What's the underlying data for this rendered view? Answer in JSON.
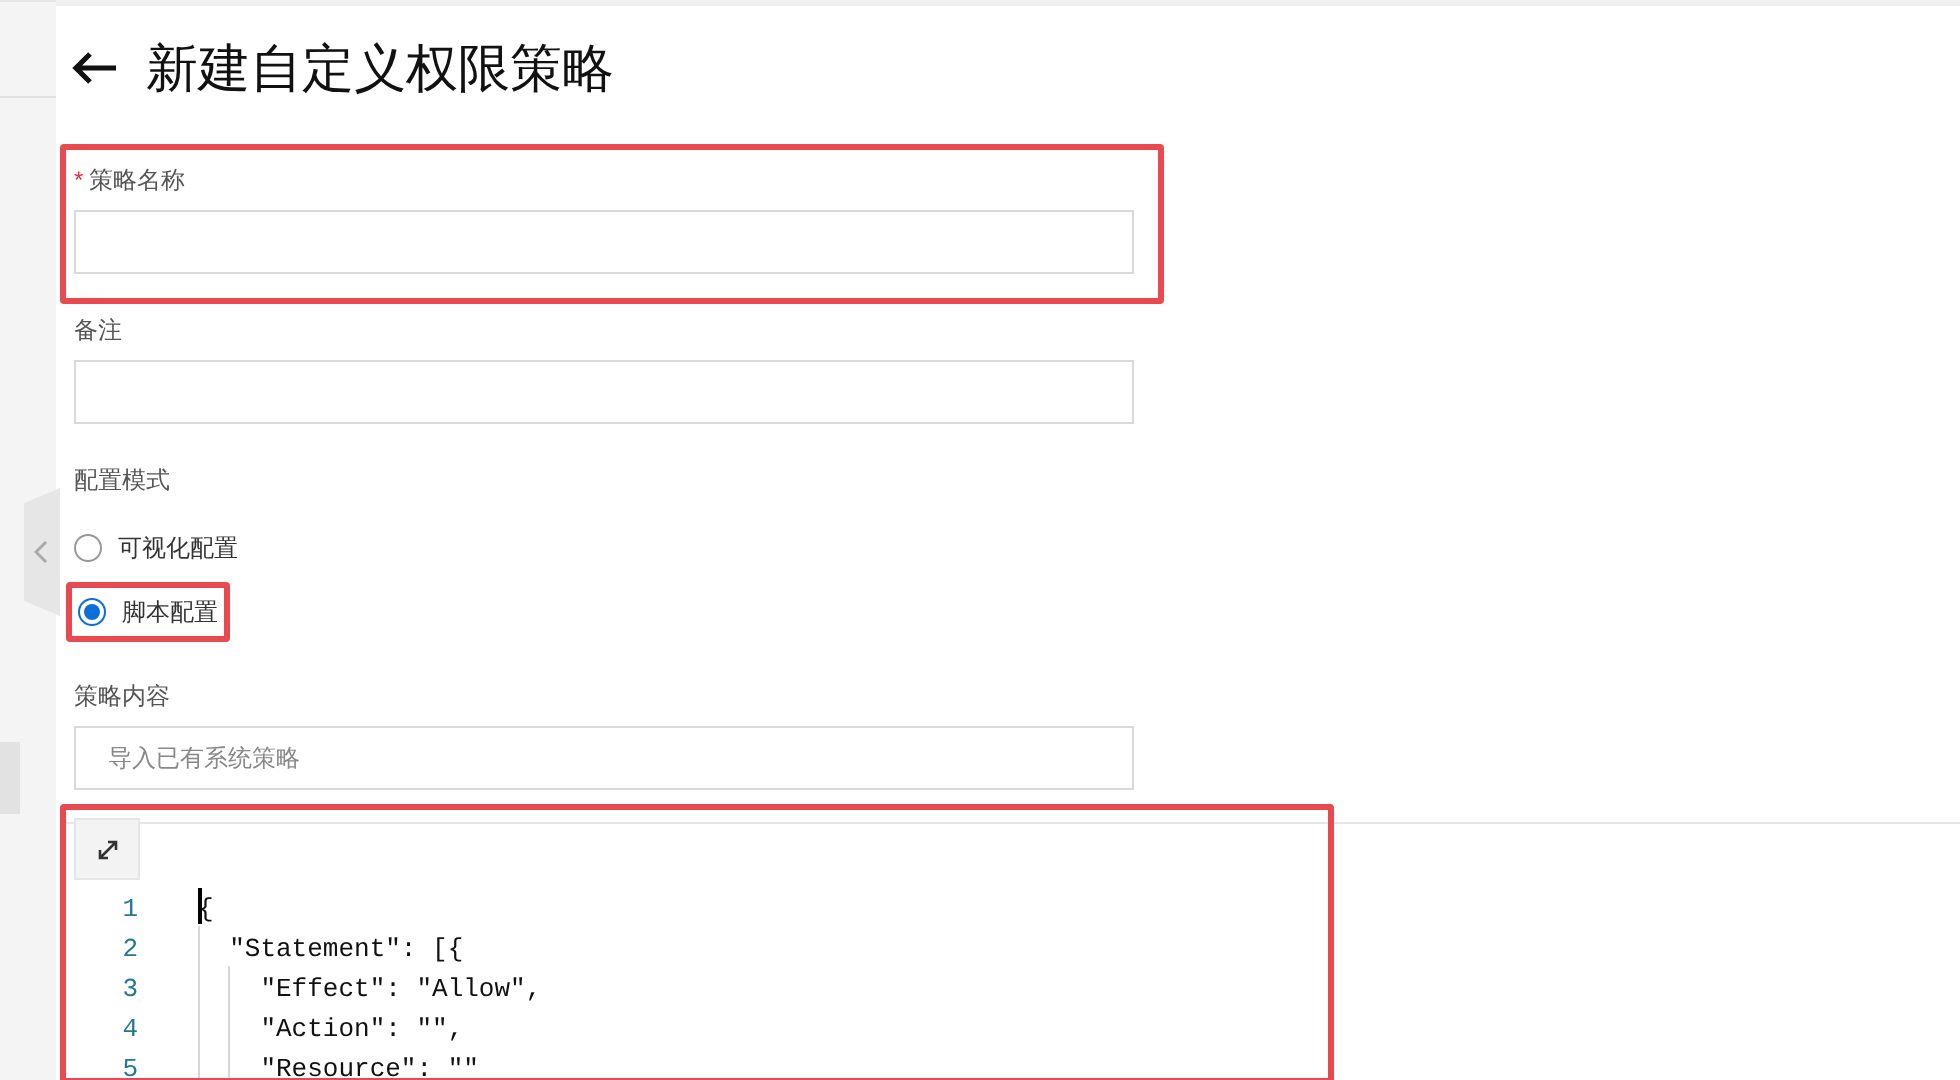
{
  "page": {
    "title": "新建自定义权限策略"
  },
  "name_field": {
    "label": "策略名称",
    "required_mark": "*"
  },
  "remark_field": {
    "label": "备注"
  },
  "mode": {
    "label": "配置模式",
    "options": [
      {
        "label": "可视化配置",
        "selected": false
      },
      {
        "label": "脚本配置",
        "selected": true
      }
    ]
  },
  "content": {
    "label": "策略内容",
    "placeholder": "导入已有系统策略"
  },
  "editor": {
    "lines": [
      {
        "number": "1",
        "text": "{"
      },
      {
        "number": "2",
        "text": "  \"Statement\": [{"
      },
      {
        "number": "3",
        "text": "    \"Effect\": \"Allow\","
      },
      {
        "number": "4",
        "text": "    \"Action\": \"\","
      },
      {
        "number": "5",
        "text": "    \"Resource\": \"\""
      }
    ]
  }
}
